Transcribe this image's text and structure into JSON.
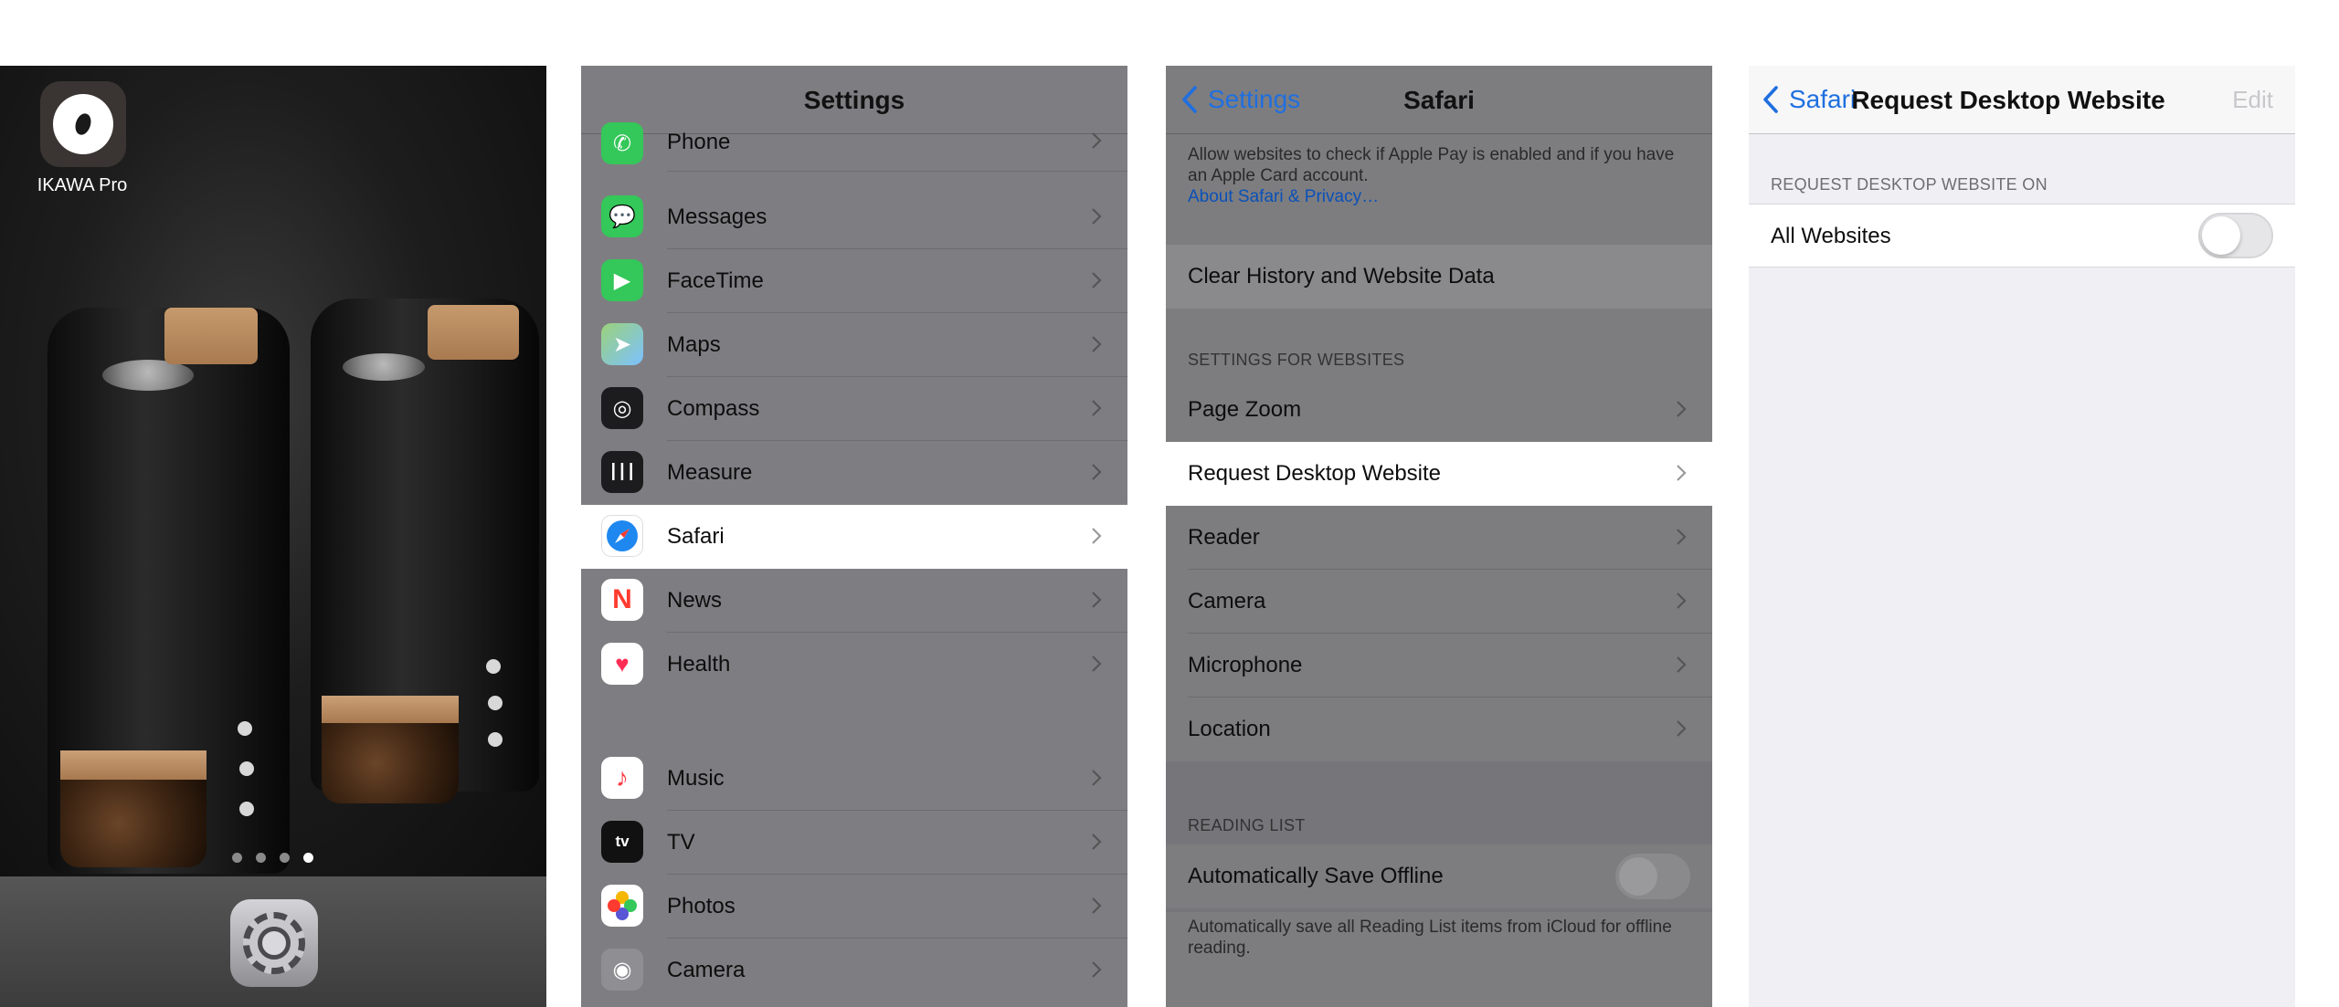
{
  "home": {
    "app_label": "IKAWA Pro",
    "page_dots": 4,
    "active_dot": 3,
    "dock_app": "settings-icon"
  },
  "settings": {
    "title": "Settings",
    "items": [
      {
        "label": "Phone",
        "icon": "phone-icon",
        "color": "#34c759"
      },
      {
        "label": "Messages",
        "icon": "messages-icon",
        "color": "#34c759"
      },
      {
        "label": "FaceTime",
        "icon": "facetime-icon",
        "color": "#34c759"
      },
      {
        "label": "Maps",
        "icon": "maps-icon",
        "color": "#7cc1ff"
      },
      {
        "label": "Compass",
        "icon": "compass-icon",
        "color": "#1c1c1e"
      },
      {
        "label": "Measure",
        "icon": "measure-icon",
        "color": "#1c1c1e"
      },
      {
        "label": "Safari",
        "icon": "safari-icon",
        "color": "#1e88f0",
        "selected": true
      },
      {
        "label": "News",
        "icon": "news-icon",
        "color": "#ff3b30"
      },
      {
        "label": "Health",
        "icon": "health-icon",
        "color": "#ff2d55"
      },
      {
        "label": "Music",
        "icon": "music-icon",
        "color": "#fc3c44"
      },
      {
        "label": "TV",
        "icon": "tv-icon",
        "color": "#111111",
        "glyph": "tv"
      },
      {
        "label": "Photos",
        "icon": "photos-icon",
        "color": "#ffcc00"
      },
      {
        "label": "Camera",
        "icon": "camera-icon",
        "color": "#8e8e93"
      }
    ]
  },
  "safari": {
    "back_label": "Settings",
    "title": "Safari",
    "privacy_text": "Allow websites to check if Apple Pay is enabled and if you have an Apple Card account.",
    "privacy_link": "About Safari & Privacy…",
    "clear_history": "Clear History and Website Data",
    "websites_header": "SETTINGS FOR WEBSITES",
    "website_items": [
      "Page Zoom",
      "Request Desktop Website",
      "Reader",
      "Camera",
      "Microphone",
      "Location"
    ],
    "selected_item": "Request Desktop Website",
    "reading_header": "READING LIST",
    "auto_save_label": "Automatically Save Offline",
    "auto_save_on": false,
    "auto_save_footer": "Automatically save all Reading List items from iCloud for offline reading."
  },
  "rdw": {
    "back_label": "Safari",
    "title": "Request Desktop Website",
    "edit_label": "Edit",
    "section_header": "REQUEST DESKTOP WEBSITE ON",
    "all_websites_label": "All Websites",
    "all_websites_on": false
  },
  "colors": {
    "ios_blue": "#1f6fe0",
    "toggle_off": "#e6e6e9",
    "grouped_bg": "#efeff4"
  }
}
